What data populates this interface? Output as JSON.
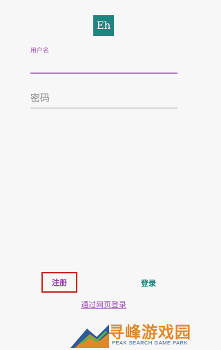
{
  "logo": {
    "text": "Eh"
  },
  "username": {
    "label": "用户名",
    "value": ""
  },
  "password": {
    "placeholder": "密码"
  },
  "actions": {
    "register_label": "注册",
    "login_label": "登录",
    "web_login_label": "通过网页登录"
  },
  "watermark": {
    "title": "寻峰游戏园",
    "subtitle": "PEAK SEARCH GAME PARK"
  },
  "colors": {
    "accent_teal": "#1f8582",
    "accent_purple": "#9c57b0",
    "highlight_red": "#cc2222",
    "watermark_orange": "#e0892a"
  }
}
